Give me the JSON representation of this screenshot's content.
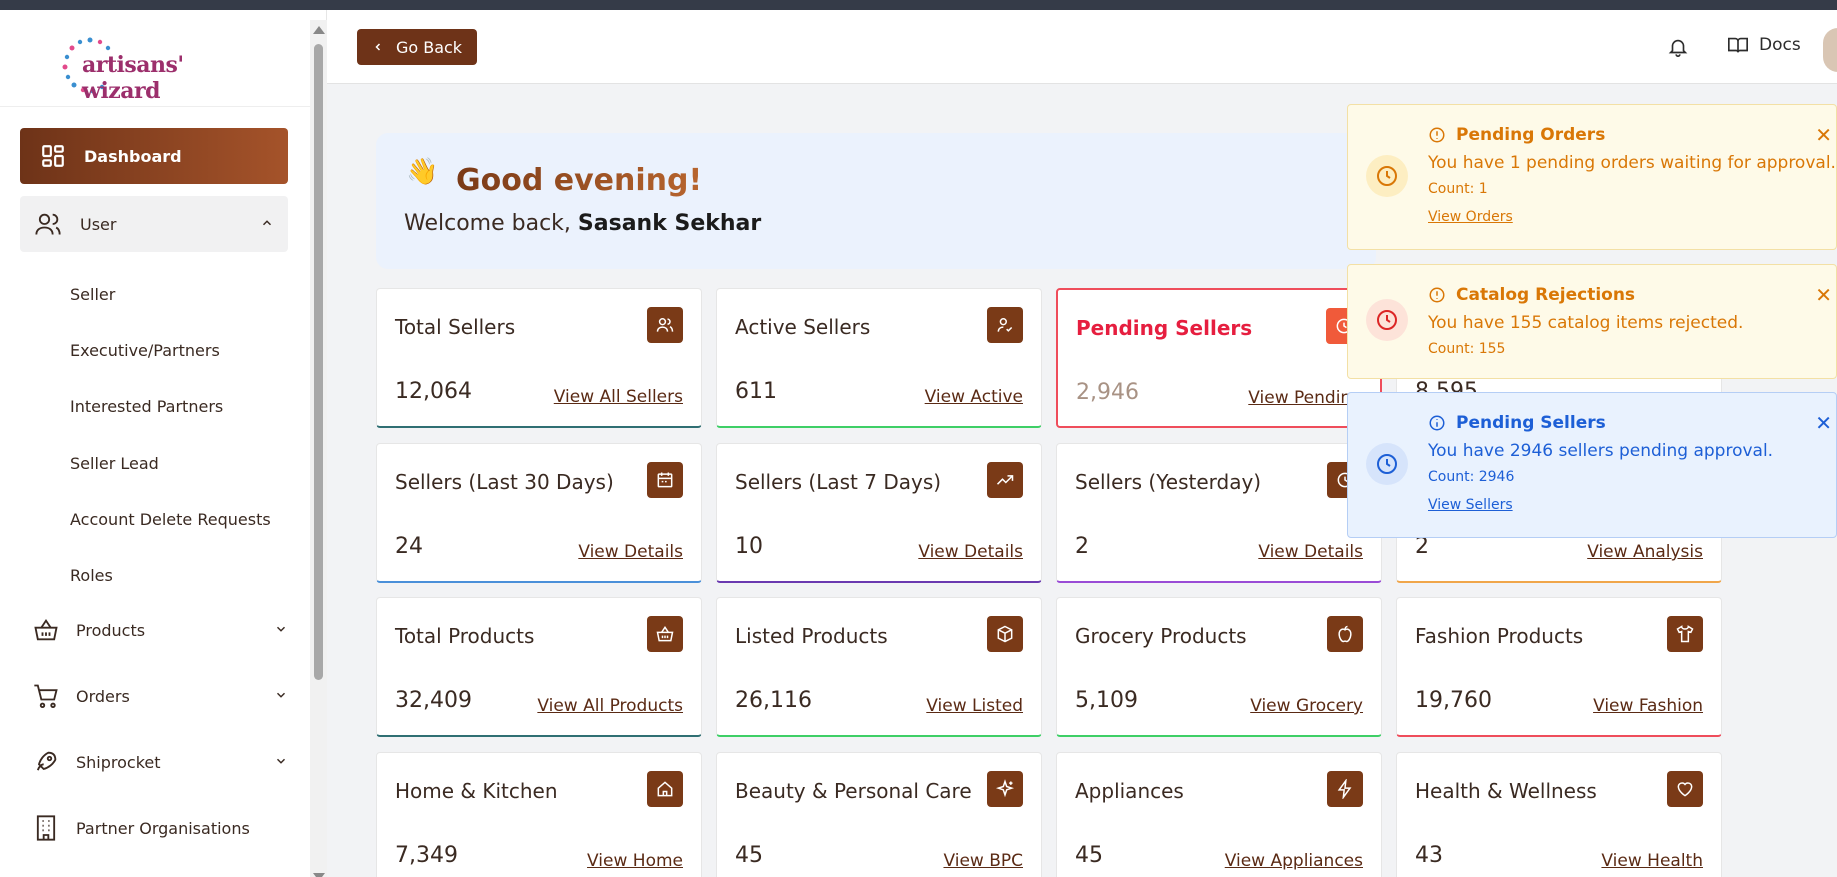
{
  "brand": {
    "name": "artisans' wizard"
  },
  "header": {
    "back_label": "Go Back",
    "docs_label": "Docs"
  },
  "sidebar": {
    "dashboard": "Dashboard",
    "user": "User",
    "user_items": [
      "Seller",
      "Executive/Partners",
      "Interested Partners",
      "Seller Lead",
      "Account Delete Requests",
      "Roles"
    ],
    "products": "Products",
    "orders": "Orders",
    "shiprocket": "Shiprocket",
    "partner_orgs": "Partner Organisations"
  },
  "greeting": {
    "title": "Good evening!",
    "welcome_prefix": "Welcome back,",
    "user_name": "Sasank Sekhar"
  },
  "cards": [
    {
      "title": "Total Sellers",
      "value": "12,064",
      "link": "View All Sellers",
      "icon": "users-icon",
      "accent": "#2f6f73"
    },
    {
      "title": "Active Sellers",
      "value": "611",
      "link": "View Active",
      "icon": "user-check-icon",
      "accent": "#3ecf66"
    },
    {
      "title": "Pending Sellers",
      "value": "2,946",
      "link": "View Pending",
      "icon": "clock-icon",
      "accent": "#ef4d5b"
    },
    {
      "title": "",
      "value": "8,595",
      "link": "",
      "icon": "",
      "accent": "#e6e6e6"
    },
    {
      "title": "Sellers (Last 30 Days)",
      "value": "24",
      "link": "View Details",
      "icon": "calendar-icon",
      "accent": "#4a90d9"
    },
    {
      "title": "Sellers (Last 7 Days)",
      "value": "10",
      "link": "View Details",
      "icon": "trend-up-icon",
      "accent": "#6a3ab0"
    },
    {
      "title": "Sellers (Yesterday)",
      "value": "2",
      "link": "View Details",
      "icon": "clock-icon",
      "accent": "#9a4cd6"
    },
    {
      "title": "",
      "value": "2",
      "link": "View Analysis",
      "icon": "",
      "accent": "#f0a64a"
    },
    {
      "title": "Total Products",
      "value": "32,409",
      "link": "View All Products",
      "icon": "basket-icon",
      "accent": "#2f6f73"
    },
    {
      "title": "Listed Products",
      "value": "26,116",
      "link": "View Listed",
      "icon": "box-icon",
      "accent": "#3ecf66"
    },
    {
      "title": "Grocery Products",
      "value": "5,109",
      "link": "View Grocery",
      "icon": "apple-icon",
      "accent": "#3ecf66"
    },
    {
      "title": "Fashion Products",
      "value": "19,760",
      "link": "View Fashion",
      "icon": "shirt-icon",
      "accent": "#ef4d5b"
    },
    {
      "title": "Home & Kitchen",
      "value": "7,349",
      "link": "View Home",
      "icon": "home-icon",
      "accent": "#e6e6e6"
    },
    {
      "title": "Beauty & Personal Care",
      "value": "45",
      "link": "View BPC",
      "icon": "sparkle-icon",
      "accent": "#e6e6e6"
    },
    {
      "title": "Appliances",
      "value": "45",
      "link": "View Appliances",
      "icon": "bolt-icon",
      "accent": "#e6e6e6"
    },
    {
      "title": "Health & Wellness",
      "value": "43",
      "link": "View Health",
      "icon": "heart-icon",
      "accent": "#e6e6e6"
    }
  ],
  "toasts": [
    {
      "title": "Pending Orders",
      "message": "You have 1 pending orders waiting for approval.",
      "count": "Count: 1",
      "link": "View Orders",
      "kind": "warn",
      "color": "#d97706"
    },
    {
      "title": "Catalog Rejections",
      "message": "You have 155 catalog items rejected.",
      "count": "Count: 155",
      "link": "",
      "kind": "warn",
      "color": "#d97706"
    },
    {
      "title": "Pending Sellers",
      "message": "You have 2946 sellers pending approval.",
      "count": "Count: 2946",
      "link": "View Sellers",
      "kind": "info",
      "color": "#1d5fd6"
    }
  ]
}
